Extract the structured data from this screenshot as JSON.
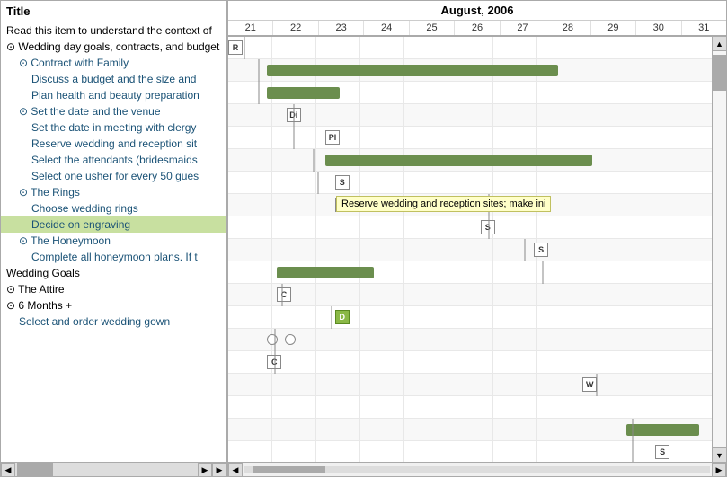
{
  "header": {
    "title": "Title",
    "month": "August, 2006",
    "days": [
      "21",
      "22",
      "23",
      "24",
      "25",
      "26",
      "27",
      "28",
      "29",
      "30",
      "31"
    ]
  },
  "tree": [
    {
      "level": 0,
      "text": "Read this item to understand the context of",
      "expand": false,
      "selected": false
    },
    {
      "level": 0,
      "text": "⊙ Wedding day goals, contracts, and budget",
      "expand": true,
      "selected": false
    },
    {
      "level": 1,
      "text": "⊙ Contract with Family",
      "expand": true,
      "selected": false
    },
    {
      "level": 2,
      "text": "Discuss a budget and the size and",
      "expand": false,
      "selected": false
    },
    {
      "level": 2,
      "text": "Plan health and beauty preparation",
      "expand": false,
      "selected": false
    },
    {
      "level": 1,
      "text": "⊙ Set the date and the venue",
      "expand": true,
      "selected": false
    },
    {
      "level": 2,
      "text": "Set the date in meeting with clergy",
      "expand": false,
      "selected": false
    },
    {
      "level": 2,
      "text": "Reserve wedding and reception sit",
      "expand": false,
      "selected": false
    },
    {
      "level": 2,
      "text": "Select the attendants (bridesmaids",
      "expand": false,
      "selected": false
    },
    {
      "level": 2,
      "text": "Select one usher for every 50 gues",
      "expand": false,
      "selected": false
    },
    {
      "level": 1,
      "text": "⊙ The Rings",
      "expand": true,
      "selected": false
    },
    {
      "level": 2,
      "text": "Choose wedding rings",
      "expand": false,
      "selected": false
    },
    {
      "level": 2,
      "text": "Decide on engraving",
      "expand": false,
      "selected": true
    },
    {
      "level": 1,
      "text": "⊙ The Honeymoon",
      "expand": true,
      "selected": false
    },
    {
      "level": 2,
      "text": "Complete all honeymoon plans. If t",
      "expand": false,
      "selected": false
    },
    {
      "level": 0,
      "text": "Wedding Goals",
      "expand": false,
      "selected": false
    },
    {
      "level": 0,
      "text": "⊙ The Attire",
      "expand": true,
      "selected": false
    },
    {
      "level": 0,
      "text": "⊙ 6 Months +",
      "expand": true,
      "selected": false
    },
    {
      "level": 1,
      "text": "Select and order wedding gown",
      "expand": false,
      "selected": false
    }
  ],
  "footer": {
    "months_label": "6 Months +"
  },
  "gantt_bars": [
    {
      "row": 0,
      "left_pct": 0,
      "width_pct": 3,
      "type": "cell",
      "label": "R"
    },
    {
      "row": 1,
      "left_pct": 8,
      "width_pct": 60,
      "type": "bar"
    },
    {
      "row": 2,
      "left_pct": 8,
      "width_pct": 15,
      "type": "bar"
    },
    {
      "row": 3,
      "left_pct": 12,
      "width_pct": 5,
      "type": "cell",
      "label": "Di"
    },
    {
      "row": 4,
      "left_pct": 20,
      "width_pct": 5,
      "type": "cell",
      "label": "Pl"
    },
    {
      "row": 5,
      "left_pct": 20,
      "width_pct": 55,
      "type": "bar"
    },
    {
      "row": 6,
      "left_pct": 22,
      "width_pct": 5,
      "type": "cell",
      "label": "S"
    },
    {
      "row": 7,
      "left_pct": 22,
      "width_pct": 5,
      "type": "cell",
      "label": "S"
    },
    {
      "row": 8,
      "left_pct": 52,
      "width_pct": 5,
      "type": "cell",
      "label": "S"
    },
    {
      "row": 9,
      "left_pct": 63,
      "width_pct": 5,
      "type": "cell",
      "label": "S"
    },
    {
      "row": 10,
      "left_pct": 10,
      "width_pct": 20,
      "type": "bar"
    },
    {
      "row": 11,
      "left_pct": 10,
      "width_pct": 5,
      "type": "cell",
      "label": "C"
    },
    {
      "row": 12,
      "left_pct": 22,
      "width_pct": 5,
      "type": "cell_filled",
      "label": "D"
    },
    {
      "row": 13,
      "left_pct": 8,
      "width_pct": 18,
      "type": "milestone"
    },
    {
      "row": 14,
      "left_pct": 8,
      "width_pct": 5,
      "type": "cell",
      "label": "C"
    },
    {
      "row": 15,
      "left_pct": 73,
      "width_pct": 5,
      "type": "cell",
      "label": "W"
    },
    {
      "row": 17,
      "left_pct": 82,
      "width_pct": 15,
      "type": "bar"
    },
    {
      "row": 18,
      "left_pct": 88,
      "width_pct": 5,
      "type": "cell",
      "label": "S"
    }
  ],
  "tooltip": {
    "text": "Reserve wedding and reception sites; make ini",
    "row": 7
  }
}
